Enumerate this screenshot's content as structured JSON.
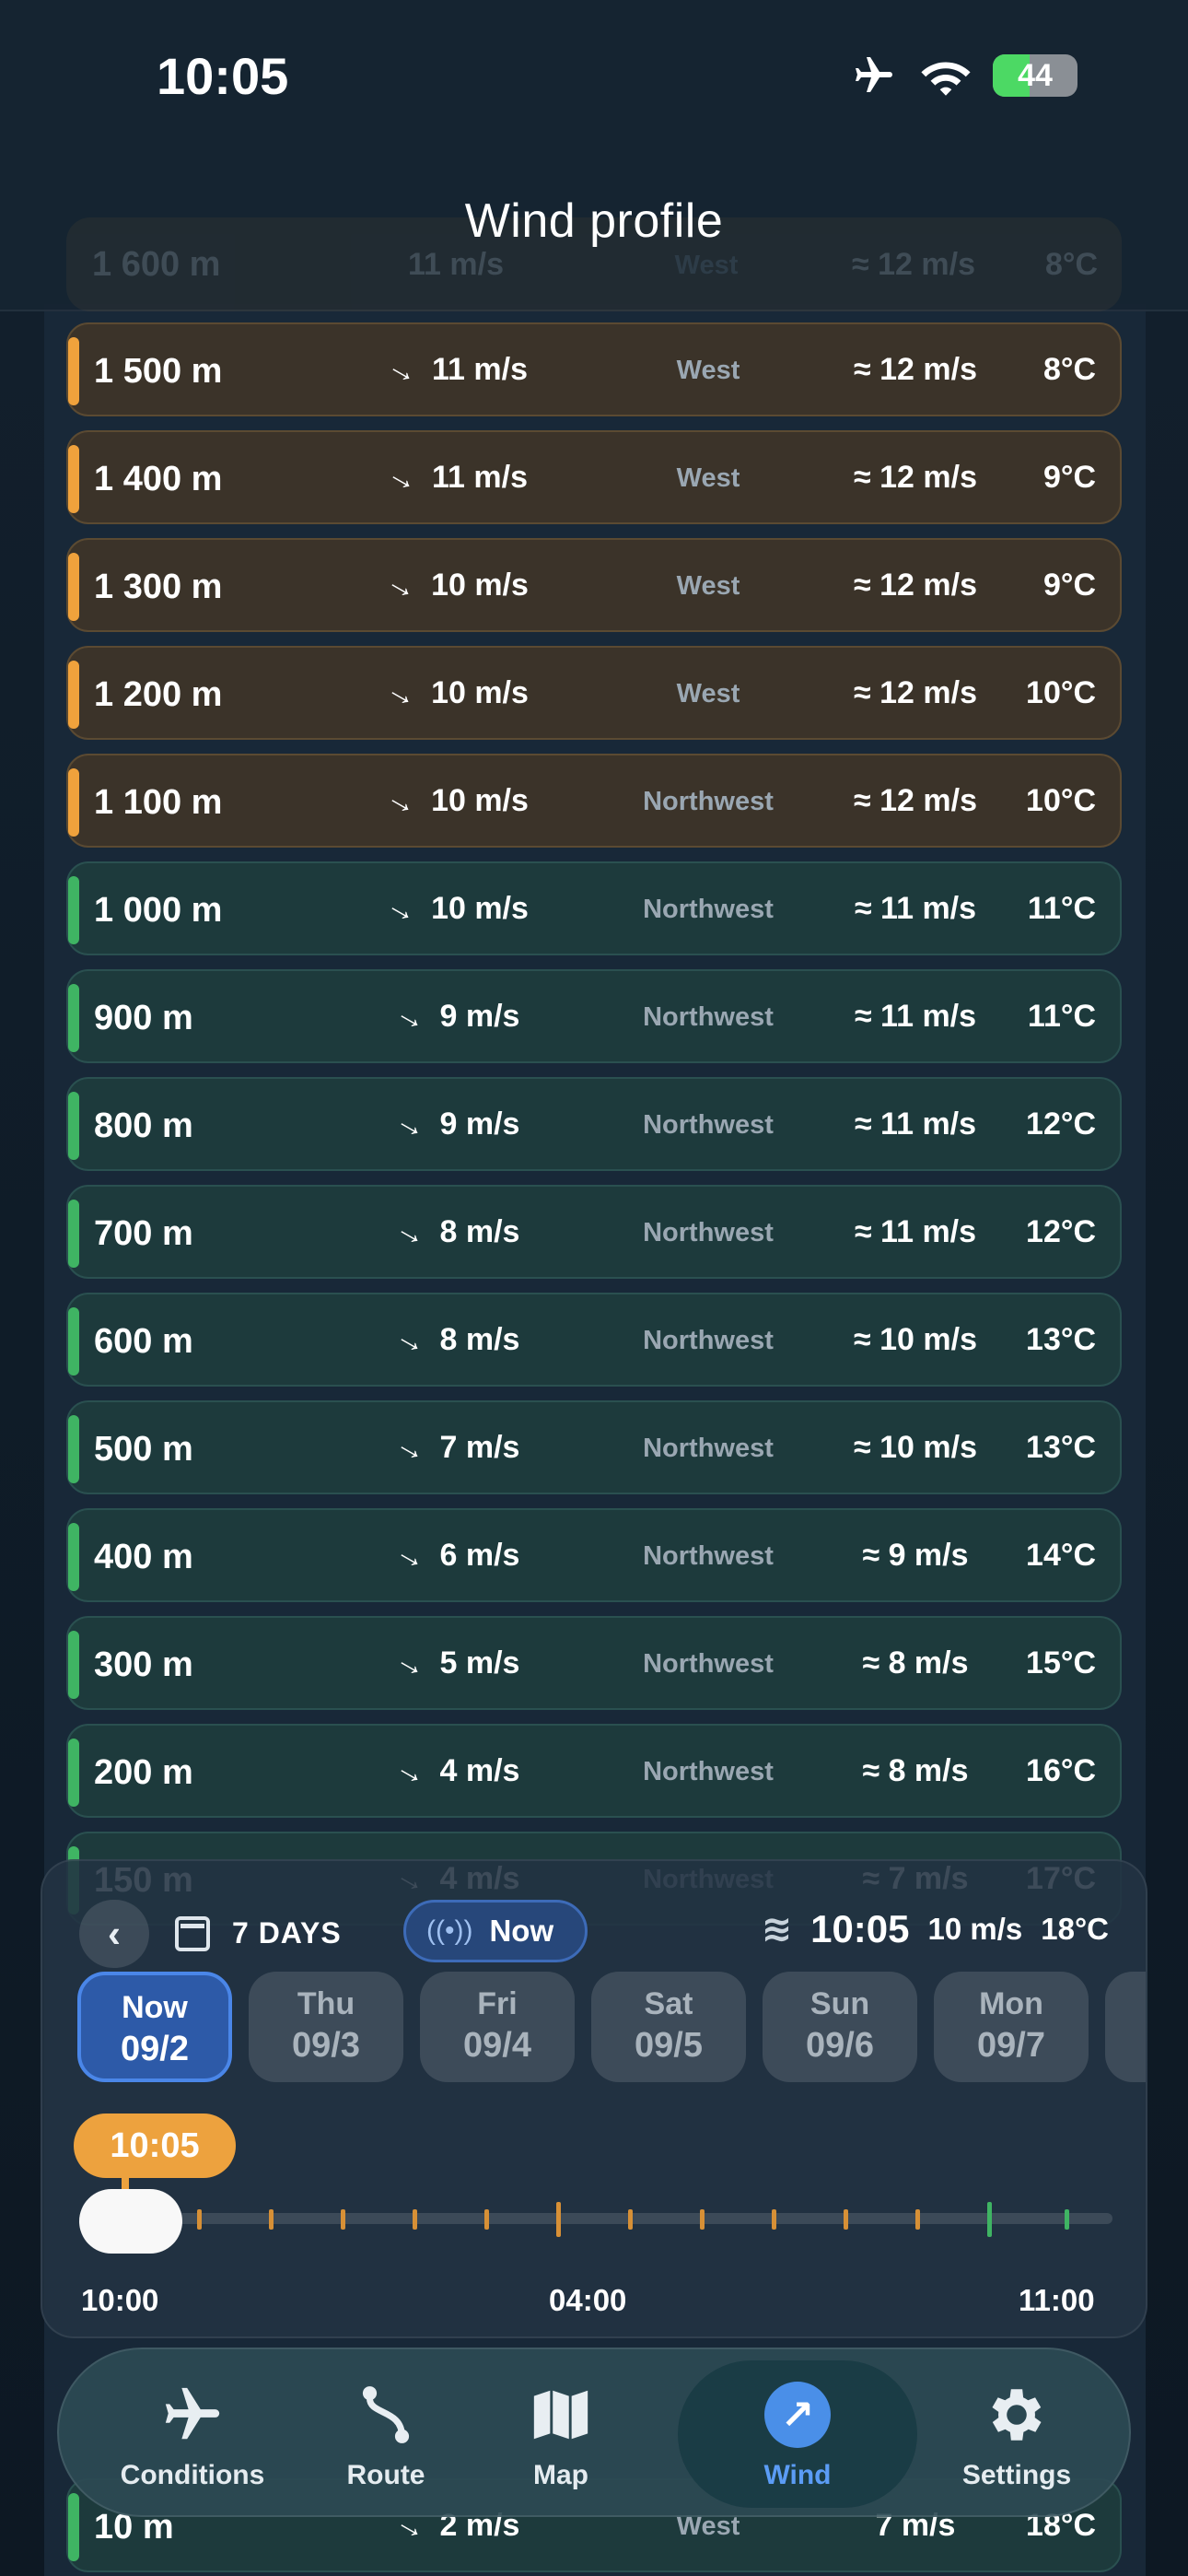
{
  "status": {
    "time": "10:05",
    "battery": "44"
  },
  "title": "Wind profile",
  "header_ghost_rows": [
    {
      "altitude": "1 600 m",
      "wind": "11 m/s",
      "direction": "West",
      "gust": "≈ 12 m/s",
      "temp": "8°C"
    }
  ],
  "rows": [
    {
      "altitude": "1 500 m",
      "wind": "11 m/s",
      "direction": "West",
      "gust": "≈ 12 m/s",
      "temp": "8°C",
      "zone": "warm"
    },
    {
      "altitude": "1 400 m",
      "wind": "11 m/s",
      "direction": "West",
      "gust": "≈ 12 m/s",
      "temp": "9°C",
      "zone": "warm"
    },
    {
      "altitude": "1 300 m",
      "wind": "10 m/s",
      "direction": "West",
      "gust": "≈ 12 m/s",
      "temp": "9°C",
      "zone": "warm"
    },
    {
      "altitude": "1 200 m",
      "wind": "10 m/s",
      "direction": "West",
      "gust": "≈ 12 m/s",
      "temp": "10°C",
      "zone": "warm"
    },
    {
      "altitude": "1 100 m",
      "wind": "10 m/s",
      "direction": "Northwest",
      "gust": "≈ 12 m/s",
      "temp": "10°C",
      "zone": "warm"
    },
    {
      "altitude": "1 000 m",
      "wind": "10 m/s",
      "direction": "Northwest",
      "gust": "≈ 11 m/s",
      "temp": "11°C",
      "zone": "cool"
    },
    {
      "altitude": "900 m",
      "wind": "9 m/s",
      "direction": "Northwest",
      "gust": "≈ 11 m/s",
      "temp": "11°C",
      "zone": "cool"
    },
    {
      "altitude": "800 m",
      "wind": "9 m/s",
      "direction": "Northwest",
      "gust": "≈ 11 m/s",
      "temp": "12°C",
      "zone": "cool"
    },
    {
      "altitude": "700 m",
      "wind": "8 m/s",
      "direction": "Northwest",
      "gust": "≈ 11 m/s",
      "temp": "12°C",
      "zone": "cool"
    },
    {
      "altitude": "600 m",
      "wind": "8 m/s",
      "direction": "Northwest",
      "gust": "≈ 10 m/s",
      "temp": "13°C",
      "zone": "cool"
    },
    {
      "altitude": "500 m",
      "wind": "7 m/s",
      "direction": "Northwest",
      "gust": "≈ 10 m/s",
      "temp": "13°C",
      "zone": "cool"
    },
    {
      "altitude": "400 m",
      "wind": "6 m/s",
      "direction": "Northwest",
      "gust": "≈ 9 m/s",
      "temp": "14°C",
      "zone": "cool"
    },
    {
      "altitude": "300 m",
      "wind": "5 m/s",
      "direction": "Northwest",
      "gust": "≈ 8 m/s",
      "temp": "15°C",
      "zone": "cool"
    },
    {
      "altitude": "200 m",
      "wind": "4 m/s",
      "direction": "Northwest",
      "gust": "≈ 8 m/s",
      "temp": "16°C",
      "zone": "cool"
    },
    {
      "altitude": "150 m",
      "wind": "4 m/s",
      "direction": "Northwest",
      "gust": "≈ 7 m/s",
      "temp": "17°C",
      "zone": "cool"
    },
    {
      "altitude": "10 m",
      "wind": "2 m/s",
      "direction": "West",
      "gust": "7 m/s",
      "temp": "18°C",
      "zone": "cool"
    }
  ],
  "timeline": {
    "days_label": "7 DAYS",
    "now_label": "Now",
    "current_time": "10:05",
    "current_wind": "10 m/s",
    "current_temp": "18°C",
    "days": [
      {
        "name": "Now",
        "date": "09/2",
        "active": true
      },
      {
        "name": "Thu",
        "date": "09/3",
        "active": false
      },
      {
        "name": "Fri",
        "date": "09/4",
        "active": false
      },
      {
        "name": "Sat",
        "date": "09/5",
        "active": false
      },
      {
        "name": "Sun",
        "date": "09/6",
        "active": false
      },
      {
        "name": "Mon",
        "date": "09/7",
        "active": false
      }
    ],
    "bubble_time": "10:05",
    "labels": {
      "start": "10:00",
      "middle": "04:00",
      "end": "11:00"
    }
  },
  "tabs": [
    {
      "label": "Conditions",
      "icon": "airplane-icon",
      "active": false
    },
    {
      "label": "Route",
      "icon": "route-icon",
      "active": false
    },
    {
      "label": "Map",
      "icon": "map-icon",
      "active": false
    },
    {
      "label": "Wind",
      "icon": "wind-arrow-icon",
      "active": true
    },
    {
      "label": "Settings",
      "icon": "gear-icon",
      "active": false
    }
  ],
  "colors": {
    "warm_accent": "#f0a23c",
    "cool_accent": "#3fb463",
    "active_blue": "#4a8fe8",
    "time_bubble": "#eda23e"
  }
}
